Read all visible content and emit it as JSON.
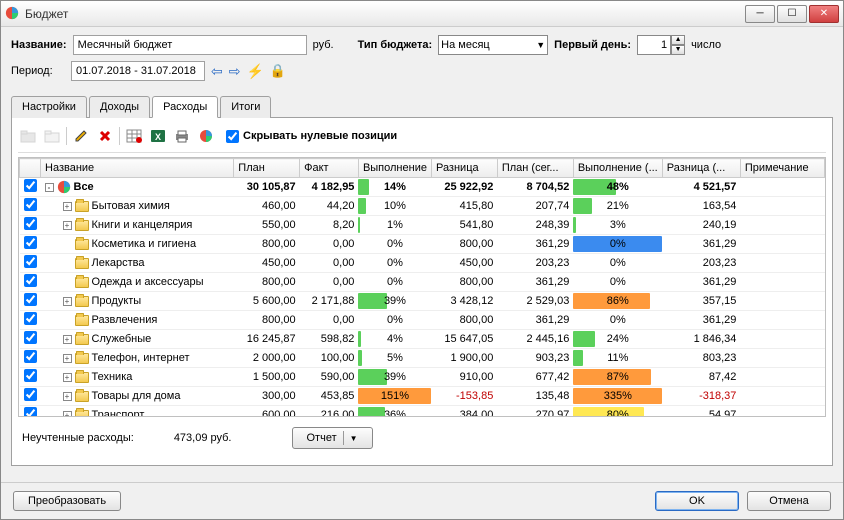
{
  "window": {
    "title": "Бюджет"
  },
  "form": {
    "name_label": "Название:",
    "name_value": "Месячный бюджет",
    "currency": "руб.",
    "type_label": "Тип бюджета:",
    "type_value": "На месяц",
    "first_day_label": "Первый день:",
    "first_day_value": "1",
    "first_day_suffix": "число",
    "period_label": "Период:",
    "period_value": "01.07.2018 - 31.07.2018"
  },
  "tabs": [
    "Настройки",
    "Доходы",
    "Расходы",
    "Итоги"
  ],
  "active_tab": 2,
  "hide_zero_label": "Скрывать нулевые позиции",
  "columns": [
    "Название",
    "План",
    "Факт",
    "Выполнение",
    "Разница",
    "План (сег...",
    "Выполнение (...",
    "Разница (...",
    "Примечание"
  ],
  "rows": [
    {
      "indent": 0,
      "icon": "app",
      "exp": "-",
      "name": "Все",
      "plan": "30 105,87",
      "fact": "4 182,95",
      "pct": "14%",
      "pctColor": "green",
      "pctW": 14,
      "diff": "25 922,92",
      "plan2": "8 704,52",
      "pct2": "48%",
      "pct2Color": "green",
      "pct2W": 48,
      "diff2": "4 521,57",
      "bold": true
    },
    {
      "indent": 1,
      "exp": "+",
      "name": "Бытовая химия",
      "plan": "460,00",
      "fact": "44,20",
      "pct": "10%",
      "pctColor": "green",
      "pctW": 10,
      "diff": "415,80",
      "plan2": "207,74",
      "pct2": "21%",
      "pct2Color": "green",
      "pct2W": 21,
      "diff2": "163,54"
    },
    {
      "indent": 1,
      "exp": "+",
      "name": "Книги и канцелярия",
      "plan": "550,00",
      "fact": "8,20",
      "pct": "1%",
      "pctColor": "green",
      "pctW": 2,
      "diff": "541,80",
      "plan2": "248,39",
      "pct2": "3%",
      "pct2Color": "green",
      "pct2W": 3,
      "diff2": "240,19"
    },
    {
      "indent": 1,
      "exp": "",
      "name": "Косметика и гигиена",
      "plan": "800,00",
      "fact": "0,00",
      "pct": "0%",
      "pctColor": "none",
      "pctW": 0,
      "diff": "800,00",
      "plan2": "361,29",
      "pct2": "0%",
      "pct2Color": "blue",
      "pct2W": 100,
      "diff2": "361,29"
    },
    {
      "indent": 1,
      "exp": "",
      "name": "Лекарства",
      "plan": "450,00",
      "fact": "0,00",
      "pct": "0%",
      "pctColor": "none",
      "pctW": 0,
      "diff": "450,00",
      "plan2": "203,23",
      "pct2": "0%",
      "pct2Color": "none",
      "pct2W": 0,
      "diff2": "203,23"
    },
    {
      "indent": 1,
      "exp": "",
      "name": "Одежда и аксессуары",
      "plan": "800,00",
      "fact": "0,00",
      "pct": "0%",
      "pctColor": "none",
      "pctW": 0,
      "diff": "800,00",
      "plan2": "361,29",
      "pct2": "0%",
      "pct2Color": "none",
      "pct2W": 0,
      "diff2": "361,29"
    },
    {
      "indent": 1,
      "exp": "+",
      "name": "Продукты",
      "plan": "5 600,00",
      "fact": "2 171,88",
      "pct": "39%",
      "pctColor": "green",
      "pctW": 39,
      "diff": "3 428,12",
      "plan2": "2 529,03",
      "pct2": "86%",
      "pct2Color": "orange",
      "pct2W": 86,
      "diff2": "357,15"
    },
    {
      "indent": 1,
      "exp": "",
      "name": "Развлечения",
      "plan": "800,00",
      "fact": "0,00",
      "pct": "0%",
      "pctColor": "none",
      "pctW": 0,
      "diff": "800,00",
      "plan2": "361,29",
      "pct2": "0%",
      "pct2Color": "none",
      "pct2W": 0,
      "diff2": "361,29"
    },
    {
      "indent": 1,
      "exp": "+",
      "name": "Служебные",
      "plan": "16 245,87",
      "fact": "598,82",
      "pct": "4%",
      "pctColor": "green",
      "pctW": 4,
      "diff": "15 647,05",
      "plan2": "2 445,16",
      "pct2": "24%",
      "pct2Color": "green",
      "pct2W": 24,
      "diff2": "1 846,34"
    },
    {
      "indent": 1,
      "exp": "+",
      "name": "Телефон, интернет",
      "plan": "2 000,00",
      "fact": "100,00",
      "pct": "5%",
      "pctColor": "green",
      "pctW": 5,
      "diff": "1 900,00",
      "plan2": "903,23",
      "pct2": "11%",
      "pct2Color": "green",
      "pct2W": 11,
      "diff2": "803,23"
    },
    {
      "indent": 1,
      "exp": "+",
      "name": "Техника",
      "plan": "1 500,00",
      "fact": "590,00",
      "pct": "39%",
      "pctColor": "green",
      "pctW": 39,
      "diff": "910,00",
      "plan2": "677,42",
      "pct2": "87%",
      "pct2Color": "orange",
      "pct2W": 87,
      "diff2": "87,42"
    },
    {
      "indent": 1,
      "exp": "+",
      "name": "Товары для дома",
      "plan": "300,00",
      "fact": "453,85",
      "pct": "151%",
      "pctColor": "orange",
      "pctW": 100,
      "diff": "-153,85",
      "diffNeg": true,
      "plan2": "135,48",
      "pct2": "335%",
      "pct2Color": "orange",
      "pct2W": 100,
      "diff2": "-318,37",
      "diff2Neg": true
    },
    {
      "indent": 1,
      "exp": "+",
      "name": "Транспорт",
      "plan": "600,00",
      "fact": "216,00",
      "pct": "36%",
      "pctColor": "green",
      "pctW": 36,
      "diff": "384,00",
      "plan2": "270,97",
      "pct2": "80%",
      "pct2Color": "yellow",
      "pct2W": 80,
      "diff2": "54,97"
    }
  ],
  "unaccounted": {
    "label": "Неучтенные расходы:",
    "value": "473,09 руб."
  },
  "report_btn": "Отчет",
  "transform_btn": "Преобразовать",
  "ok_btn": "OK",
  "cancel_btn": "Отмена"
}
